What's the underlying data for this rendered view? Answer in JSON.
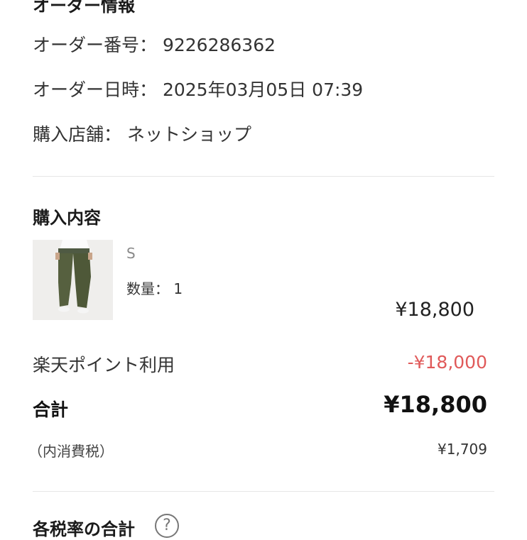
{
  "order_info": {
    "heading": "オーダー情報",
    "order_number_label": "オーダー番号：",
    "order_number": "9226286362",
    "order_date_label": "オーダー日時：",
    "order_date": "2025年03月05日 07:39",
    "store_label": "購入店舗：",
    "store": "ネットショップ"
  },
  "purchase": {
    "heading": "購入内容",
    "item": {
      "image_icon": "pants-product-photo",
      "size": "S",
      "quantity_label": "数量：",
      "quantity": "1",
      "price": "¥18,800"
    }
  },
  "summary": {
    "points_label": "楽天ポイント利用",
    "points_value": "-¥18,000",
    "total_label": "合計",
    "total_value": "¥18,800",
    "tax_label": "（内消費税）",
    "tax_value": "¥1,709"
  },
  "tax_section": {
    "heading": "各税率の合計",
    "help_icon_glyph": "?"
  },
  "colors": {
    "discount": "#e05a5a",
    "divider": "#e6e6e6",
    "text": "#222222"
  }
}
